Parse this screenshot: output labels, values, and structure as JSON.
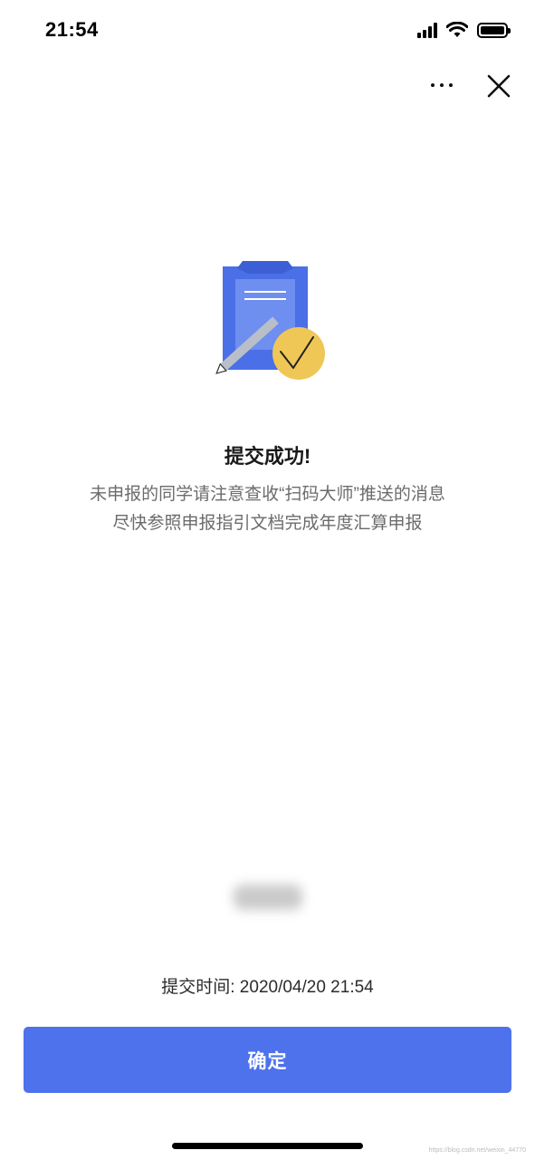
{
  "status_bar": {
    "time": "21:54",
    "icons": [
      "signal-icon",
      "wifi-icon",
      "battery-icon"
    ]
  },
  "nav": {
    "more_icon": "more-icon",
    "close_icon": "close-icon"
  },
  "illustration": {
    "icon": "clipboard-check-icon",
    "colors": {
      "clipboard": "#4a6fe6",
      "paper": "#6e8ff0",
      "check_circle": "#efc756",
      "pencil": "#b9bfc8"
    }
  },
  "result": {
    "title": "提交成功!",
    "message_line1": "未申报的同学请注意查收“扫码大师”推送的消息",
    "message_line2": "尽快参照申报指引文档完成年度汇算申报"
  },
  "submit_time": "提交时间: 2020/04/20 21:54",
  "confirm_button": {
    "label": "确定",
    "color": "#4d72ec"
  },
  "watermark": "https://blog.csdn.net/weixin_44770"
}
